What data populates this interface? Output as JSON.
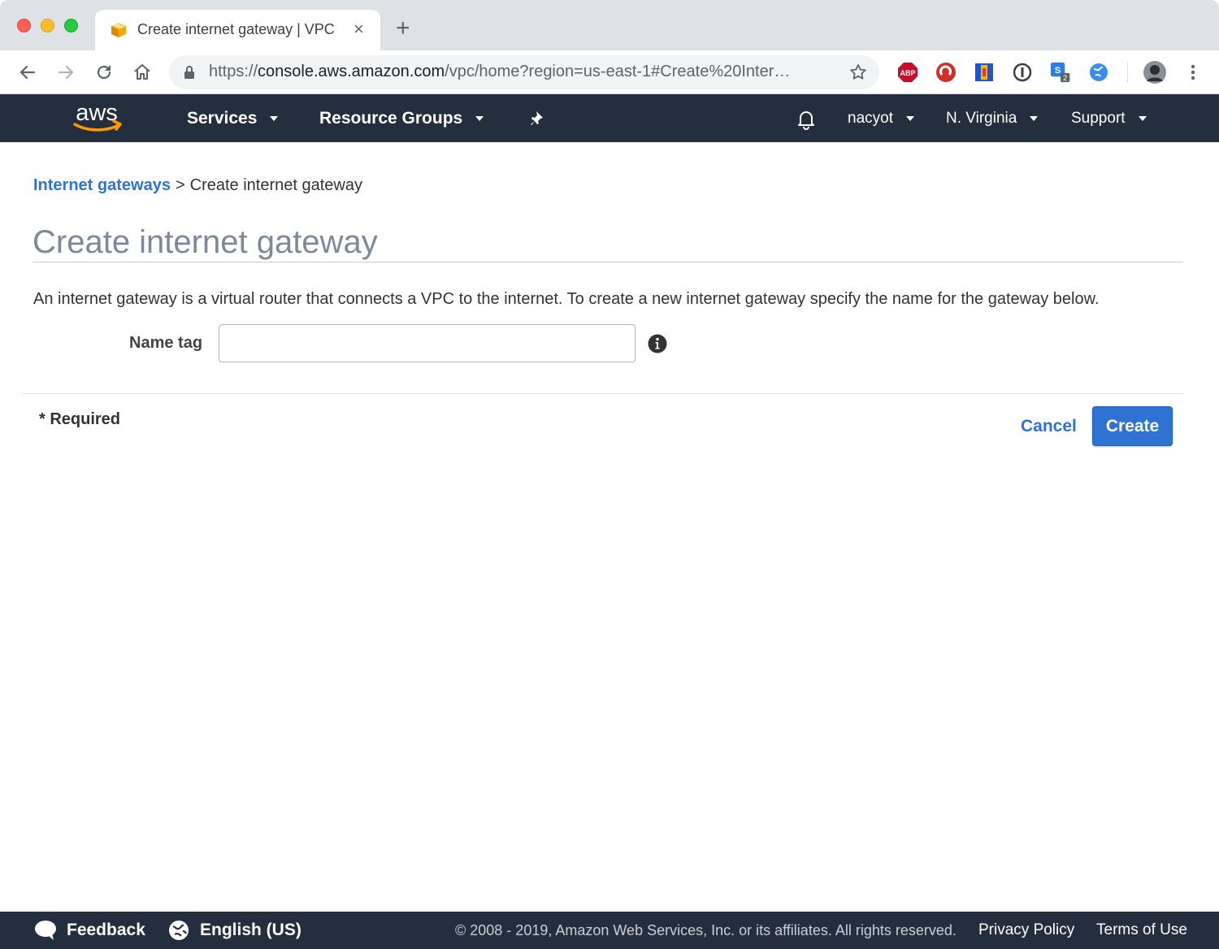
{
  "browser": {
    "tab_title": "Create internet gateway | VPC",
    "new_tab": "+",
    "close_tab": "×",
    "url_scheme": "https://",
    "url_host": "console.aws.amazon.com",
    "url_path": "/vpc/home?region=us-east-1#Create%20Inter…",
    "extensions": [
      "abp-icon",
      "lastpass-icon",
      "bookmark-extension-icon",
      "onepassword-icon",
      "skype-icon",
      "globe-extension-icon"
    ],
    "ext_abp_label": "ABP",
    "ext_badge": "2"
  },
  "aws_nav": {
    "logo_text": "aws",
    "services": "Services",
    "resource_groups": "Resource Groups",
    "account": "nacyot",
    "region": "N. Virginia",
    "support": "Support"
  },
  "breadcrumb": {
    "link": "Internet gateways",
    "separator": ">",
    "current": "Create internet gateway"
  },
  "page": {
    "title": "Create internet gateway",
    "description": "An internet gateway is a virtual router that connects a VPC to the internet. To create a new internet gateway specify the name for the gateway below.",
    "name_tag_label": "Name tag",
    "name_tag_value": "",
    "required_note": "* Required",
    "cancel": "Cancel",
    "create": "Create"
  },
  "footer": {
    "feedback": "Feedback",
    "language": "English (US)",
    "copyright": "© 2008 - 2019, Amazon Web Services, Inc. or its affiliates. All rights reserved.",
    "privacy": "Privacy Policy",
    "terms": "Terms of Use"
  },
  "colors": {
    "aws_nav_bg": "#232f3e",
    "link_blue": "#2e73d3",
    "aws_orange": "#ff9900"
  }
}
